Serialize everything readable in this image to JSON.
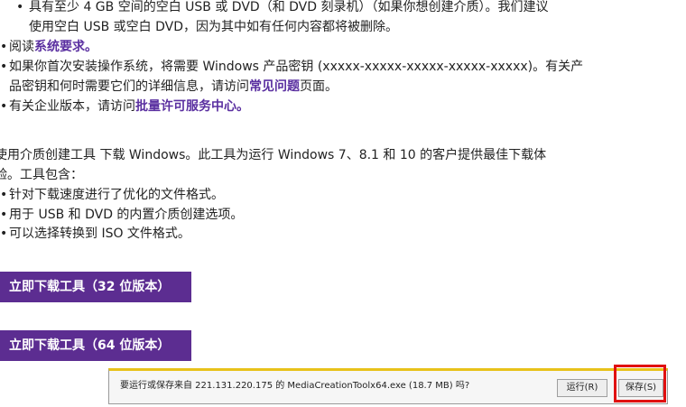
{
  "bullets_top": {
    "sub_bullet": "•",
    "item1_line1": "具有至少 4 GB 空间的空白 USB 或 DVD（和 DVD 刻录机）（如果你想创建介质）。我们建议",
    "item1_line2": "使用空白 USB 或空白 DVD，因为其中如有任何内容都将被删除。",
    "item2_prefix": "阅读",
    "item2_link": "系统要求。",
    "item3_line1": "如果你首次安装操作系统，将需要 Windows 产品密钥 (xxxxx-xxxxx-xxxxx-xxxxx-xxxxx)。有关产",
    "item3_line2_prefix": "品密钥和何时需要它们的详细信息，请访问",
    "item3_link": "常见问题",
    "item3_suffix": "页面。",
    "item4_prefix": "有关企业版本，请访问",
    "item4_link": "批量许可服务中心。",
    "bullet": "•"
  },
  "intro": {
    "line1": "使用介质创建工具 下载 Windows。此工具为运行 Windows 7、8.1 和 10 的客户提供最佳下载体",
    "line2": "验。工具包含："
  },
  "features": [
    "针对下载速度进行了优化的文件格式。",
    "用于 USB 和 DVD 的内置介质创建选项。",
    "可以选择转换到 ISO 文件格式。"
  ],
  "download_buttons": {
    "bit32": "立即下载工具（32 位版本）",
    "bit64": "立即下载工具（64 位版本）"
  },
  "notification_bar": {
    "message": "要运行或保存来自 221.131.220.175 的 MediaCreationToolx64.exe (18.7 MB) 吗?",
    "run_label": "运行(R)",
    "save_label": "保存(S)"
  },
  "colors": {
    "accent": "#5c2d91",
    "link": "#5a2fa0",
    "highlight": "#e01010",
    "bar_top": "#e8c21a"
  }
}
